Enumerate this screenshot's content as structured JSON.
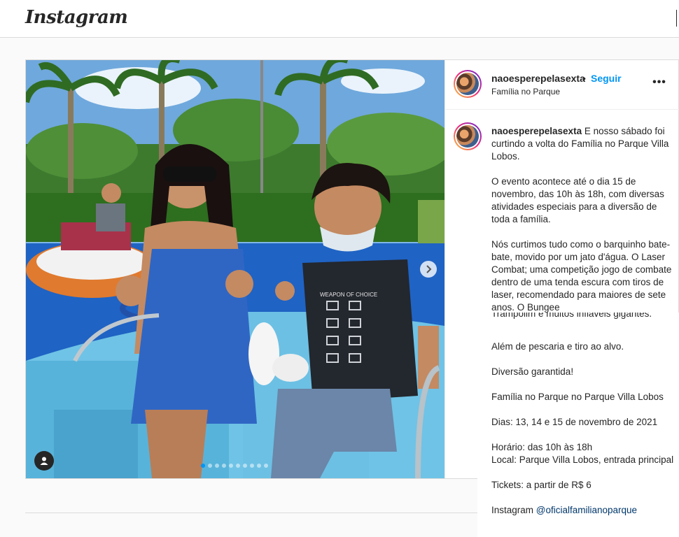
{
  "app": {
    "logo": "Instagram"
  },
  "post": {
    "username": "naoesperepelasexta",
    "separator": "•",
    "follow_label": "Seguir",
    "location": "Família no Parque",
    "more_icon": "more-horizontal-icon",
    "carousel": {
      "slide_count": 10,
      "active_index": 0
    }
  },
  "caption": {
    "username": "naoesperepelasexta",
    "intro": " E nosso sábado foi curtindo a volta do Família no Parque Villa Lobos.",
    "p1": "O evento acontece até o dia 15 de novembro, das 10h às 18h, com diversas atividades especiais para a diversão de toda a família.",
    "p2": "Nós curtimos tudo como o barquinho bate-bate, movido por um jato d'água. O Laser Combat; uma competição jogo de combate dentro de uma tenda escura com tiros de laser, recomendado para maiores de sete anos. O Bungee",
    "p2_cont": "Trampolim e muitos infláveis gigantes.",
    "p3": "Além de pescaria e tiro ao alvo.",
    "p4": "Diversão garantida!",
    "p5": "Família no Parque no Parque Villa Lobos",
    "p6": "Dias: 13, 14 e 15 de novembro de 2021",
    "p7a": "Horário: das 10h às 18h",
    "p7b": "Local: Parque Villa Lobos, entrada principal",
    "p8": "Tickets: a partir de R$ 6",
    "p9_prefix": "Instagram ",
    "p9_link": "@oficialfamilianoparque"
  },
  "colors": {
    "accent": "#0095f6",
    "text": "#262626",
    "border": "#dbdbdb",
    "link": "#00376b"
  }
}
